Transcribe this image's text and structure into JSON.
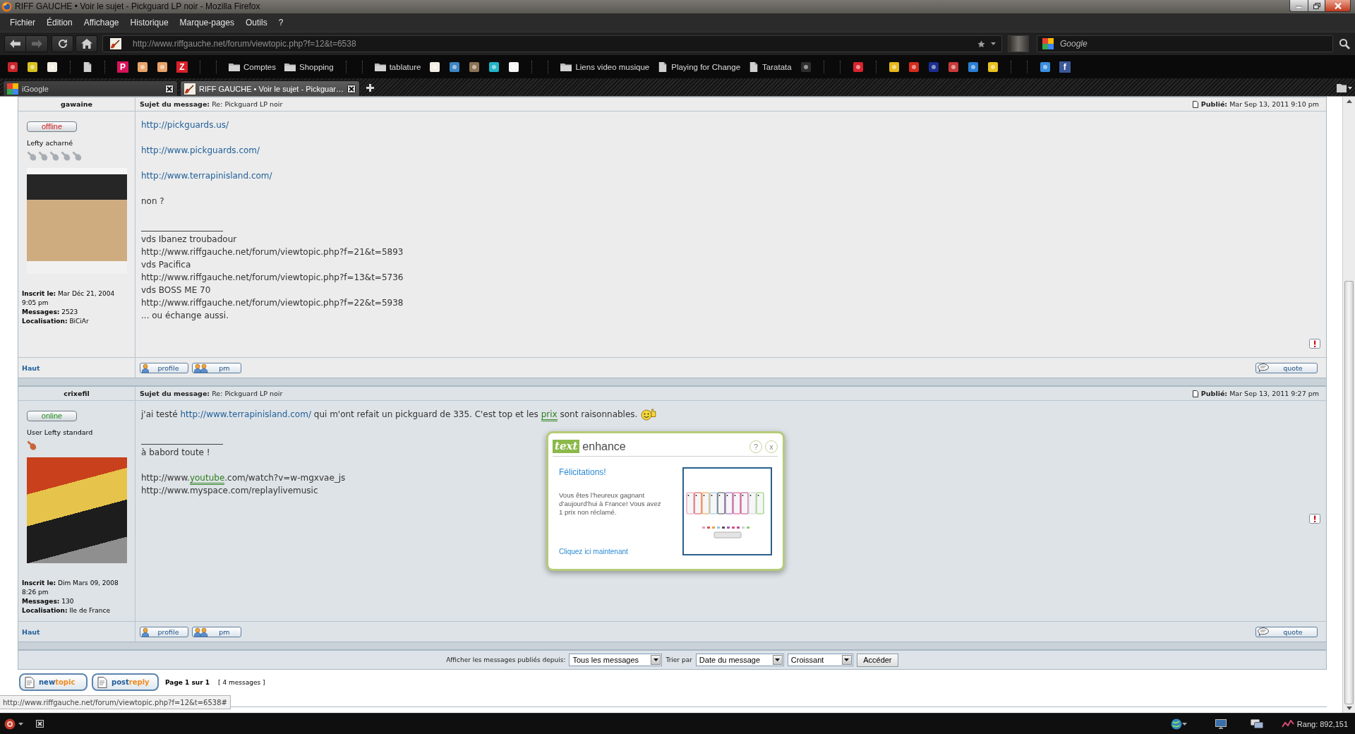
{
  "window": {
    "title": "RIFF GAUCHE • Voir le sujet - Pickguard LP noir - Mozilla Firefox"
  },
  "menu_bar": [
    "Fichier",
    "Édition",
    "Affichage",
    "Historique",
    "Marque-pages",
    "Outils",
    "?"
  ],
  "nav_bar": {
    "url": "http://www.riffgauche.net/forum/viewtopic.php?f=12&t=6538",
    "search": {
      "placeholder": "Google"
    }
  },
  "bookmarks": [
    {
      "kind": "favicon",
      "color": "#c8262c"
    },
    {
      "kind": "favicon",
      "color": "#d9c21f"
    },
    {
      "kind": "favicon",
      "color": "#f3eee4"
    },
    {
      "kind": "separator"
    },
    {
      "kind": "page"
    },
    {
      "kind": "separator"
    },
    {
      "kind": "letter",
      "text": "P",
      "color": "#d8125b"
    },
    {
      "kind": "favicon",
      "color": "#e9a46a"
    },
    {
      "kind": "favicon",
      "color": "#e9a46a"
    },
    {
      "kind": "letter",
      "text": "Z",
      "color": "#d8202a"
    },
    {
      "kind": "separator"
    },
    {
      "kind": "separator"
    },
    {
      "kind": "folder",
      "label": "Comptes"
    },
    {
      "kind": "folder",
      "label": "Shopping"
    },
    {
      "kind": "separator"
    },
    {
      "kind": "separator"
    },
    {
      "kind": "folder",
      "label": "tablature"
    },
    {
      "kind": "favicon",
      "color": "#f3eee4"
    },
    {
      "kind": "favicon",
      "color": "#3d86c6"
    },
    {
      "kind": "favicon",
      "color": "#8c7356"
    },
    {
      "kind": "favicon",
      "color": "#23b4c8"
    },
    {
      "kind": "favicon",
      "color": "#f5f5f5"
    },
    {
      "kind": "separator"
    },
    {
      "kind": "separator"
    },
    {
      "kind": "folder",
      "label": "Liens video musique"
    },
    {
      "kind": "page",
      "label": "Playing for Change"
    },
    {
      "kind": "page",
      "label": "Taratata"
    },
    {
      "kind": "favicon",
      "color": "#2e2e2e"
    },
    {
      "kind": "separator"
    },
    {
      "kind": "separator"
    },
    {
      "kind": "favicon",
      "color": "#d8232e"
    },
    {
      "kind": "separator"
    },
    {
      "kind": "favicon",
      "color": "#e6b81c"
    },
    {
      "kind": "favicon",
      "color": "#d52b1e"
    },
    {
      "kind": "favicon",
      "color": "#1b2f8f"
    },
    {
      "kind": "favicon",
      "color": "#c93a3a"
    },
    {
      "kind": "favicon",
      "color": "#2a7fd4"
    },
    {
      "kind": "favicon",
      "color": "#e8c21e"
    },
    {
      "kind": "separator"
    },
    {
      "kind": "separator"
    },
    {
      "kind": "favicon",
      "color": "#3b8fe0"
    },
    {
      "kind": "letter",
      "text": "f",
      "color": "#3b5998"
    }
  ],
  "tabs": [
    {
      "label": "iGoogle",
      "selected": false
    },
    {
      "label": "RIFF GAUCHE • Voir le sujet - Pickguar…",
      "selected": true
    }
  ],
  "posts": [
    {
      "author": "gawaine",
      "subject": "**Sujet du message:** Re: Pickguard LP noir",
      "posted": "**Publié:** Mar Sep 13, 2011 9:10 pm",
      "status": {
        "label": "offline",
        "online": false
      },
      "rank": {
        "title": "Lefty acharné",
        "icons": [
          {
            "kind": "guitar",
            "color": "#a7adb3"
          },
          {
            "kind": "guitar",
            "color": "#a7adb3"
          },
          {
            "kind": "guitar",
            "color": "#a7adb3"
          },
          {
            "kind": "guitar",
            "color": "#a7adb3"
          },
          {
            "kind": "guitar",
            "color": "#a7adb3"
          }
        ]
      },
      "avatar": {
        "kind": "photo"
      },
      "profile": [
        "**Inscrit le:** Mar Déc 21, 2004 9:05 pm",
        "**Messages:** 2523",
        "**Localisation:** BiCiAr"
      ],
      "lines": [
        {
          "kind": "link",
          "text": "http://pickguards.us/"
        },
        {
          "kind": "blank"
        },
        {
          "kind": "link",
          "text": "http://www.pickguards.com/"
        },
        {
          "kind": "blank"
        },
        {
          "kind": "link",
          "text": "http://www.terrapinisland.com/"
        },
        {
          "kind": "blank"
        },
        {
          "kind": "text",
          "text": "non ?"
        },
        {
          "kind": "blank"
        },
        {
          "kind": "rule"
        },
        {
          "kind": "text",
          "text": "vds Ibanez troubadour"
        },
        {
          "kind": "text",
          "text": "http://www.riffgauche.net/forum/viewtopic.php?f=21&t=5893"
        },
        {
          "kind": "text",
          "text": "vds Pacifica"
        },
        {
          "kind": "text",
          "text": "http://www.riffgauche.net/forum/viewtopic.php?f=13&t=5736"
        },
        {
          "kind": "text",
          "text": "vds BOSS ME 70"
        },
        {
          "kind": "text",
          "text": "http://www.riffgauche.net/forum/viewtopic.php?f=22&t=5938"
        },
        {
          "kind": "text",
          "text": "... ou échange aussi."
        }
      ],
      "report": true,
      "top_link": "Haut",
      "buttons": [
        {
          "kind": "profile",
          "label": "profile"
        },
        {
          "kind": "pm",
          "label": "pm"
        }
      ],
      "quote": {
        "kind": "quote",
        "label": "quote"
      }
    },
    {
      "author": "crixefil",
      "subject": "**Sujet du message:** Re: Pickguard LP noir",
      "posted": "**Publié:** Mar Sep 13, 2011 9:27 pm",
      "status": {
        "label": "online",
        "online": true
      },
      "rank": {
        "title": "User Lefty standard",
        "icons": [
          {
            "kind": "guitar",
            "color": "#c8643a"
          }
        ]
      },
      "avatar": {
        "kind": "photo"
      },
      "profile": [
        "**Inscrit le:** Dim Mars 09, 2008 8:26 pm",
        "**Messages:** 130",
        "**Localisation:** Ile de France"
      ],
      "lines": [
        {
          "kind": "mixed",
          "segments": [
            {
              "kind": "text",
              "text": "j'ai testé "
            },
            {
              "kind": "link",
              "text": "http://www.terrapinisland.com/"
            },
            {
              "kind": "text",
              "text": " qui m'ont refait un pickguard de 335. C'est top et les "
            },
            {
              "kind": "enhanced-link",
              "text": "prix"
            },
            {
              "kind": "text",
              "text": " sont raisonnables."
            },
            {
              "kind": "smiley"
            }
          ]
        },
        {
          "kind": "blank"
        },
        {
          "kind": "rule"
        },
        {
          "kind": "text",
          "text": "à babord toute !"
        },
        {
          "kind": "blank"
        },
        {
          "kind": "mixed",
          "segments": [
            {
              "kind": "text",
              "text": "http://www."
            },
            {
              "kind": "enhanced-link",
              "text": "youtube"
            },
            {
              "kind": "text",
              "text": ".com/watch?v=w-mgxvae_js"
            }
          ]
        },
        {
          "kind": "text",
          "text": "http://www.myspace.com/replaylivemusic"
        }
      ],
      "report": true,
      "top_link": "Haut",
      "buttons": [
        {
          "kind": "profile",
          "label": "profile"
        },
        {
          "kind": "pm",
          "label": "pm"
        }
      ],
      "quote": {
        "kind": "quote",
        "label": "quote"
      }
    }
  ],
  "sort_bar": {
    "filter_label": "Afficher les messages publiés depuis:",
    "filter": "Tous les messages",
    "sort_label": "Trier par",
    "sort_key": "Date du message",
    "order": "Croissant",
    "submit": "Accéder"
  },
  "footer": {
    "buttons": [
      {
        "kind": "new-topic",
        "parts": [
          "new",
          "topic"
        ]
      },
      {
        "kind": "post-reply",
        "parts": [
          "post",
          "reply"
        ]
      }
    ],
    "page": "Page 1 sur 1",
    "count": "[ 4 messages ]"
  },
  "popup": {
    "logo_badge": "text",
    "logo_word": "enhance",
    "help": "?",
    "close": "x",
    "heading": "Félicitations!",
    "message": "Vous êtes l’heureux gagnant d’aujourd’hui à France! Vous avez 1 prix non réclamé.",
    "link": "Cliquez ici maintenant",
    "ad": {
      "kind": "banner"
    }
  },
  "link_preview": "http://www.riffgauche.net/forum/viewtopic.php?f=12&t=6538#",
  "status_bar": {
    "rank": "Rang: 892,151"
  }
}
